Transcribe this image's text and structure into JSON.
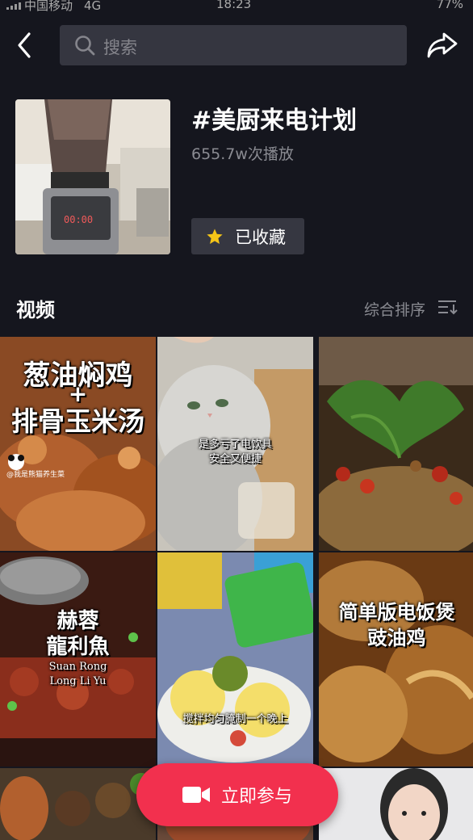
{
  "status_bar": {
    "carrier": "中国移动",
    "network": "4G",
    "time": "18:23",
    "battery": "77%"
  },
  "search": {
    "placeholder": "搜索"
  },
  "topic": {
    "title": "#美厨来电计划",
    "plays": "655.7w次播放",
    "favorite_label": "已收藏"
  },
  "section": {
    "title": "视频",
    "sort_label": "综合排序"
  },
  "videos": [
    {
      "caption_line1": "葱油焖鸡",
      "caption_plus": "+",
      "caption_line2": "排骨玉米汤",
      "watermark": "@我是熊猫养生菜"
    },
    {
      "caption_line1": "是多亏了电饮具",
      "caption_line2": "安全又便捷"
    },
    {
      "caption_line1": ""
    },
    {
      "caption_line1": "赫蓉",
      "caption_line2": "龍利魚",
      "caption_line3": "Suan Rong",
      "caption_line4": "Long Li Yu"
    },
    {
      "caption_line1": "搅拌均匀腌制一个晚上"
    },
    {
      "caption_line1": "简单版电饭煲",
      "caption_line2": "豉油鸡"
    },
    {
      "caption_line1": ""
    },
    {
      "caption_line1": ""
    },
    {
      "caption_line1": ""
    }
  ],
  "join_button": {
    "label": "立即参与"
  },
  "colors": {
    "background": "#15161e",
    "accent": "#f2304e",
    "star": "#f5c518"
  }
}
